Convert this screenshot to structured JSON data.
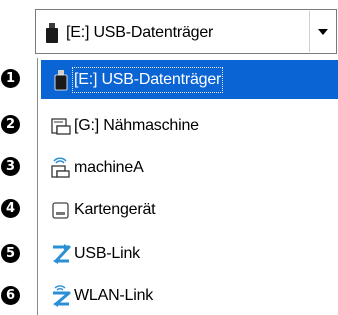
{
  "combo": {
    "selected_label": "[E:] USB-Datenträger",
    "selected_icon": "usb-stick-icon"
  },
  "list": {
    "items": [
      {
        "number": "1",
        "label": "[E:] USB-Datenträger",
        "icon": "usb-stick-icon",
        "selected": true
      },
      {
        "number": "2",
        "label": "[G:] Nähmaschine",
        "icon": "machine-drive-icon"
      },
      {
        "number": "3",
        "label": "machineA",
        "icon": "wireless-machine-icon"
      },
      {
        "number": "4",
        "label": "Kartengerät",
        "icon": "card-reader-icon"
      },
      {
        "number": "5",
        "label": "USB-Link",
        "icon": "usb-link-icon"
      },
      {
        "number": "6",
        "label": "WLAN-Link",
        "icon": "wlan-link-icon"
      }
    ]
  },
  "colors": {
    "selection": "#0a64d4",
    "link_icon": "#2b8fd6"
  }
}
